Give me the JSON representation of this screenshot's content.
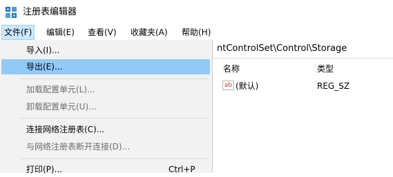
{
  "window": {
    "title": "注册表编辑器"
  },
  "menubar": {
    "items": [
      {
        "label": "文件(F)"
      },
      {
        "label": "编辑(E)"
      },
      {
        "label": "查看(V)"
      },
      {
        "label": "收藏夹(A)"
      },
      {
        "label": "帮助(H)"
      }
    ]
  },
  "address": {
    "path": "ntControlSet\\Control\\Storage"
  },
  "file_menu": {
    "items": [
      {
        "label": "导入(I)..."
      },
      {
        "label": "导出(E)..."
      },
      {
        "label": "加载配置单元(L)..."
      },
      {
        "label": "卸载配置单元(U)..."
      },
      {
        "label": "连接网络注册表(C)..."
      },
      {
        "label": "与网络注册表断开连接(D)..."
      },
      {
        "label": "打印(P)...",
        "shortcut": "Ctrl+P"
      }
    ]
  },
  "list": {
    "columns": {
      "name": "名称",
      "type": "类型"
    },
    "rows": [
      {
        "icon": "ab",
        "name": "(默认)",
        "type": "REG_SZ"
      }
    ]
  },
  "colors": {
    "highlight": "#91c9f7",
    "menu_bg": "#f2f2f2",
    "active_menu": "#cce8ff"
  }
}
